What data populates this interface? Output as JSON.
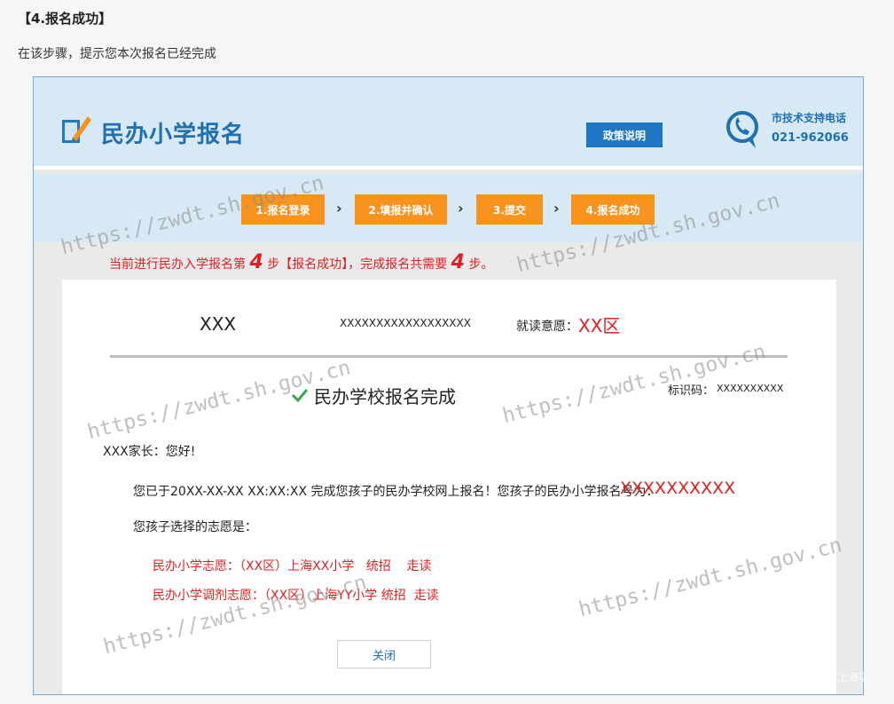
{
  "doc": {
    "heading": "【4.报名成功】",
    "description": "在该步骤，提示您本次报名已经完成"
  },
  "header": {
    "brand": "民办小学报名",
    "policy_button": "政策说明",
    "support_label": "市技术支持电话",
    "support_phone": "021-962066"
  },
  "steps": [
    {
      "label": "1.报名登录"
    },
    {
      "label": "2.填报并确认"
    },
    {
      "label": "3.提交"
    },
    {
      "label": "4.报名成功"
    }
  ],
  "step_separator": "›",
  "progress": {
    "prefix": "当前进行民办入学报名第",
    "current": "4",
    "middle": "步【报名成功】，完成报名共需要",
    "total": "4",
    "suffix": "步。"
  },
  "card": {
    "name": "XXX",
    "id_number": "XXXXXXXXXXXXXXXXXX",
    "will_label": "就读意愿：",
    "will_value": "XX区",
    "complete_title": "民办学校报名完成",
    "code_label": "标识码：",
    "code_value": "XXXXXXXXXX",
    "greeting": "XXX家长：您好!",
    "done_text": "您已于20XX-XX-XX XX:XX:XX 完成您孩子的民办学校网上报名！您孩子的民办小学报名号为：",
    "registration_number": "XXXXXXXXXX",
    "choice_label": "您孩子选择的志愿是：",
    "preference_1": "民办小学志愿：（XX区）上海XX小学   统招    走读",
    "preference_2": "民办小学调剂志愿：（XX区）上海YY小学 统招  走读",
    "close_button": "关闭"
  },
  "watermark": "https://zwdt.sh.gov.cn",
  "corner_mark": "上海学",
  "colors": {
    "accent_blue": "#1f6fb2",
    "step_orange": "#f7931e",
    "alert_red": "#e02020",
    "header_bg": "#d7e9f4"
  }
}
